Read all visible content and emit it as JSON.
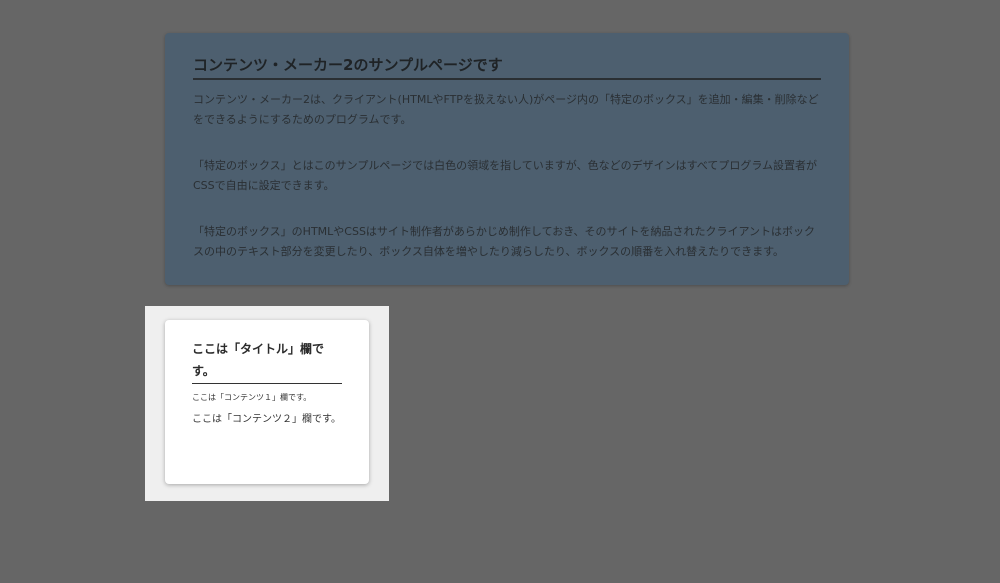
{
  "intro": {
    "title": "コンテンツ・メーカー2のサンプルページです",
    "paragraphs": [
      "コンテンツ・メーカー2は、クライアント(HTMLやFTPを扱えない人)がページ内の「特定のボックス」を追加・編集・削除などをできるようにするためのプログラムです。",
      "「特定のボックス」とはこのサンプルページでは白色の領域を指していますが、色などのデザインはすべてプログラム設置者がCSSで自由に設定できます。",
      "「特定のボックス」のHTMLやCSSはサイト制作者があらかじめ制作しておき、そのサイトを納品されたクライアントはボックスの中のテキスト部分を変更したり、ボックス自体を増やしたり減らしたり、ボックスの順番を入れ替えたりできます。"
    ]
  },
  "box": {
    "title": "ここは「タイトル」欄です。",
    "content1": "ここは「コンテンツ１」欄です。",
    "content2": "ここは「コンテンツ２」欄です。"
  },
  "colors": {
    "page_background": "#666666",
    "intro_panel": "#4d5f6f",
    "highlight_area": "#efefef",
    "box_background": "#ffffff"
  }
}
